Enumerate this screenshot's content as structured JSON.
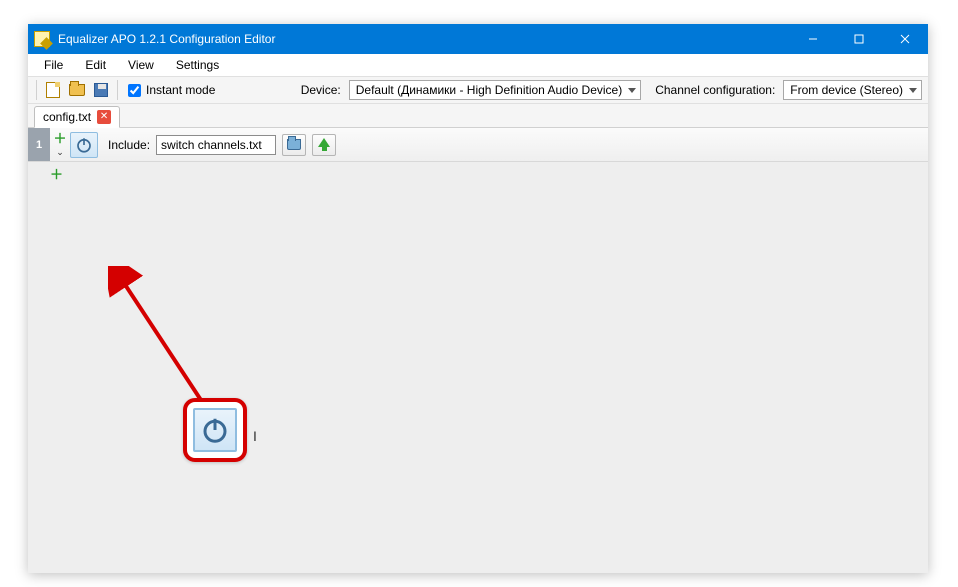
{
  "window": {
    "title": "Equalizer APO 1.2.1 Configuration Editor"
  },
  "menu": {
    "file": "File",
    "edit": "Edit",
    "view": "View",
    "settings": "Settings"
  },
  "toolbar": {
    "instant_mode_label": "Instant mode",
    "instant_mode_checked": true,
    "device_label": "Device:",
    "device_value": "Default (Динамики - High Definition Audio Device)",
    "channel_cfg_label": "Channel configuration:",
    "channel_cfg_value": "From device (Stereo)"
  },
  "tabs": {
    "active": "config.txt"
  },
  "row": {
    "number": "1",
    "include_label": "Include:",
    "include_value": "switch channels.txt"
  },
  "icons": {
    "power": "power-icon",
    "open": "open-folder-icon",
    "move_up": "arrow-up-icon",
    "add": "plus-icon"
  },
  "colors": {
    "titlebar": "#0078d7",
    "highlight_border": "#d40000",
    "arrow": "#d40000",
    "power_stroke": "#3a6a95"
  }
}
